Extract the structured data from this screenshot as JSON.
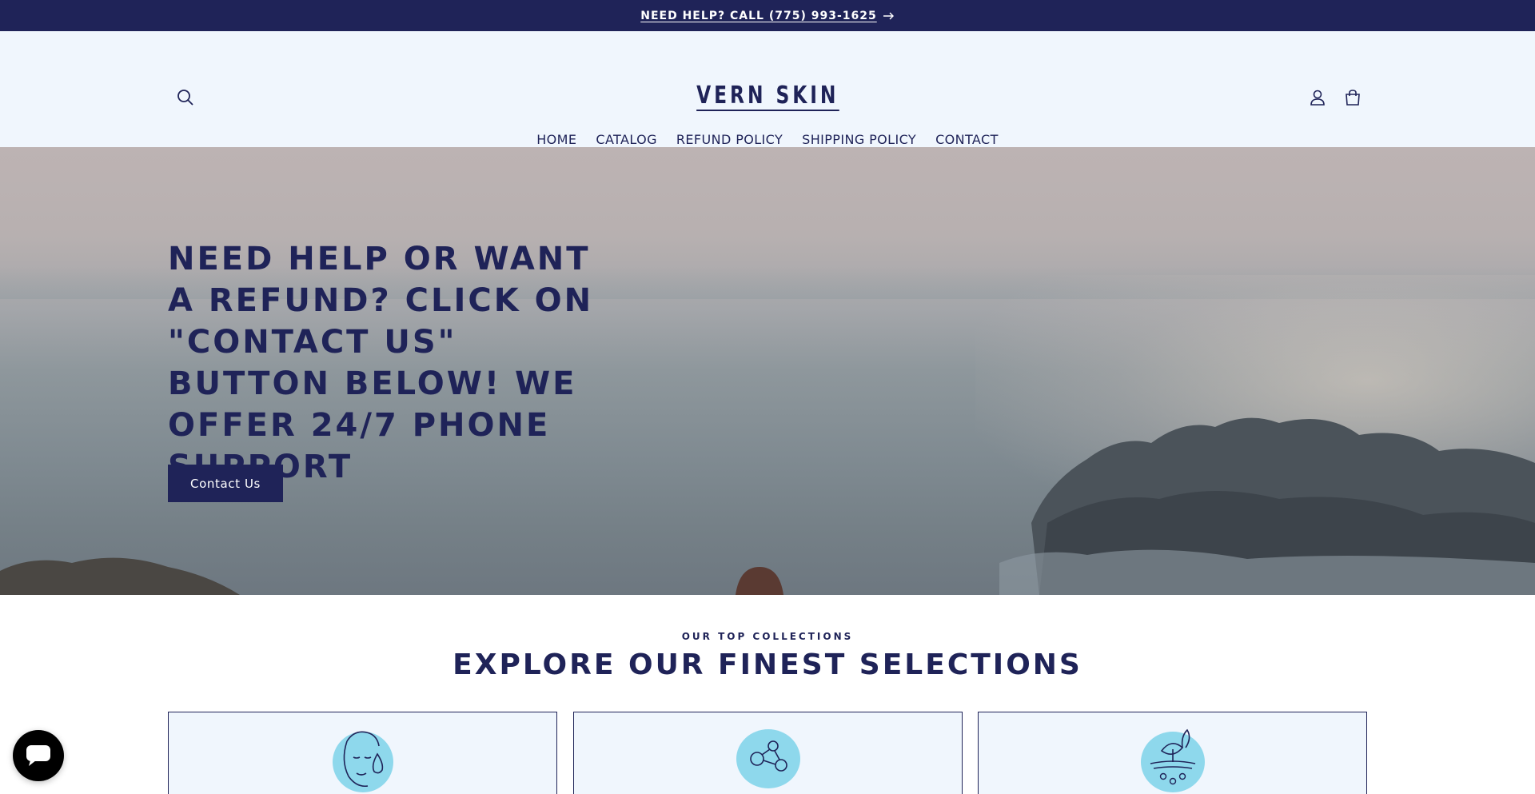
{
  "announcement": {
    "text": "NEED HELP? CALL (775) 993-1625",
    "arrow_icon": "arrow-right-icon"
  },
  "header": {
    "logo_text": "VERN SKIN",
    "icons": {
      "search": "search-icon",
      "account": "user-icon",
      "cart": "cart-icon"
    },
    "nav": [
      {
        "label": "HOME"
      },
      {
        "label": "CATALOG"
      },
      {
        "label": "REFUND POLICY"
      },
      {
        "label": "SHIPPING POLICY"
      },
      {
        "label": "CONTACT"
      }
    ]
  },
  "hero": {
    "title": "NEED HELP OR WANT A REFUND? CLICK ON \"CONTACT US\" BUTTON BELOW! WE OFFER 24/7 PHONE SUPPORT",
    "button_label": "Contact Us"
  },
  "collections": {
    "eyebrow": "OUR TOP COLLECTIONS",
    "title": "EXPLORE OUR FINEST SELECTIONS",
    "cards": [
      {
        "icon": "face-droplet-icon"
      },
      {
        "icon": "molecule-icon"
      },
      {
        "icon": "leaf-soil-icon"
      }
    ]
  },
  "chat": {
    "icon": "chat-bubble-icon"
  },
  "colors": {
    "brand_navy": "#1f2358",
    "header_bg": "#f0f6fd",
    "icon_blue": "#8ed8ec",
    "chat_bg": "#000000"
  }
}
